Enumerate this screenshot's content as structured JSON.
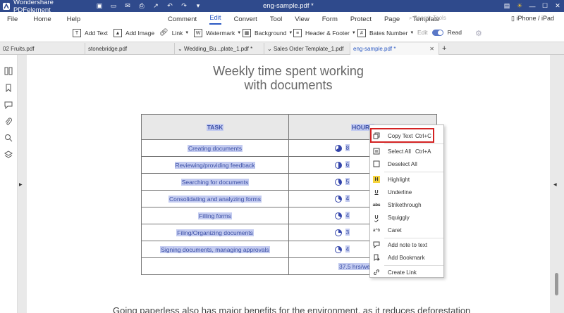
{
  "titlebar": {
    "app_name": "Wondershare PDFelement",
    "doc_title": "eng-sample.pdf *"
  },
  "menubar": {
    "left": [
      "File",
      "Home",
      "Help"
    ],
    "tabs": [
      "Comment",
      "Edit",
      "Convert",
      "Tool",
      "View",
      "Form",
      "Protect",
      "Page",
      "Template"
    ],
    "active_tab": "Edit",
    "search_placeholder": "Search Tools",
    "device_label": "iPhone / iPad"
  },
  "toolbar": {
    "add_text": "Add Text",
    "add_image": "Add Image",
    "link": "Link",
    "watermark": "Watermark",
    "background": "Background",
    "header_footer": "Header & Footer",
    "bates_number": "Bates Number",
    "edit": "Edit",
    "read": "Read"
  },
  "tabs": [
    {
      "label": "02 Fruits.pdf"
    },
    {
      "label": "stonebridge.pdf"
    },
    {
      "label": "Wedding_Bu...plate_1.pdf *"
    },
    {
      "label": "Sales Order Template_1.pdf"
    },
    {
      "label": "eng-sample.pdf *"
    }
  ],
  "page": {
    "title_line1": "Weekly time spent working",
    "title_line2": "with documents",
    "bottom_text": "Going paperless also has major benefits for the environment, as it reduces deforestation",
    "table": {
      "header_task": "TASK",
      "header_hours": "HOURS",
      "rows": [
        {
          "task": "Creating documents",
          "hours": "8"
        },
        {
          "task": "Reviewing/providing feedback",
          "hours": "6"
        },
        {
          "task": "Searching for documents",
          "hours": "5"
        },
        {
          "task": "Consolidating and analyzing forms",
          "hours": "4"
        },
        {
          "task": "Filling forms",
          "hours": "4"
        },
        {
          "task": "Filing/Organizing documents",
          "hours": "3"
        },
        {
          "task": "Signing documents, managing approvals",
          "hours": "4"
        }
      ],
      "total": "37.5 hrs/we"
    }
  },
  "context_menu": {
    "copy_text": "Copy Text",
    "copy_shortcut": "Ctrl+C",
    "select_all": "Select All",
    "select_all_shortcut": "Ctrl+A",
    "deselect_all": "Deselect All",
    "highlight": "Highlight",
    "underline": "Underline",
    "strikethrough": "Strikethrough",
    "squiggly": "Squiggly",
    "caret": "Caret",
    "add_note": "Add note to text",
    "add_bookmark": "Add Bookmark",
    "create_link": "Create Link"
  },
  "colors": {
    "titlebar": "#2f4a8c",
    "accent": "#2b59c3",
    "highlight": "#c3cbf0",
    "callout": "#d32222"
  }
}
